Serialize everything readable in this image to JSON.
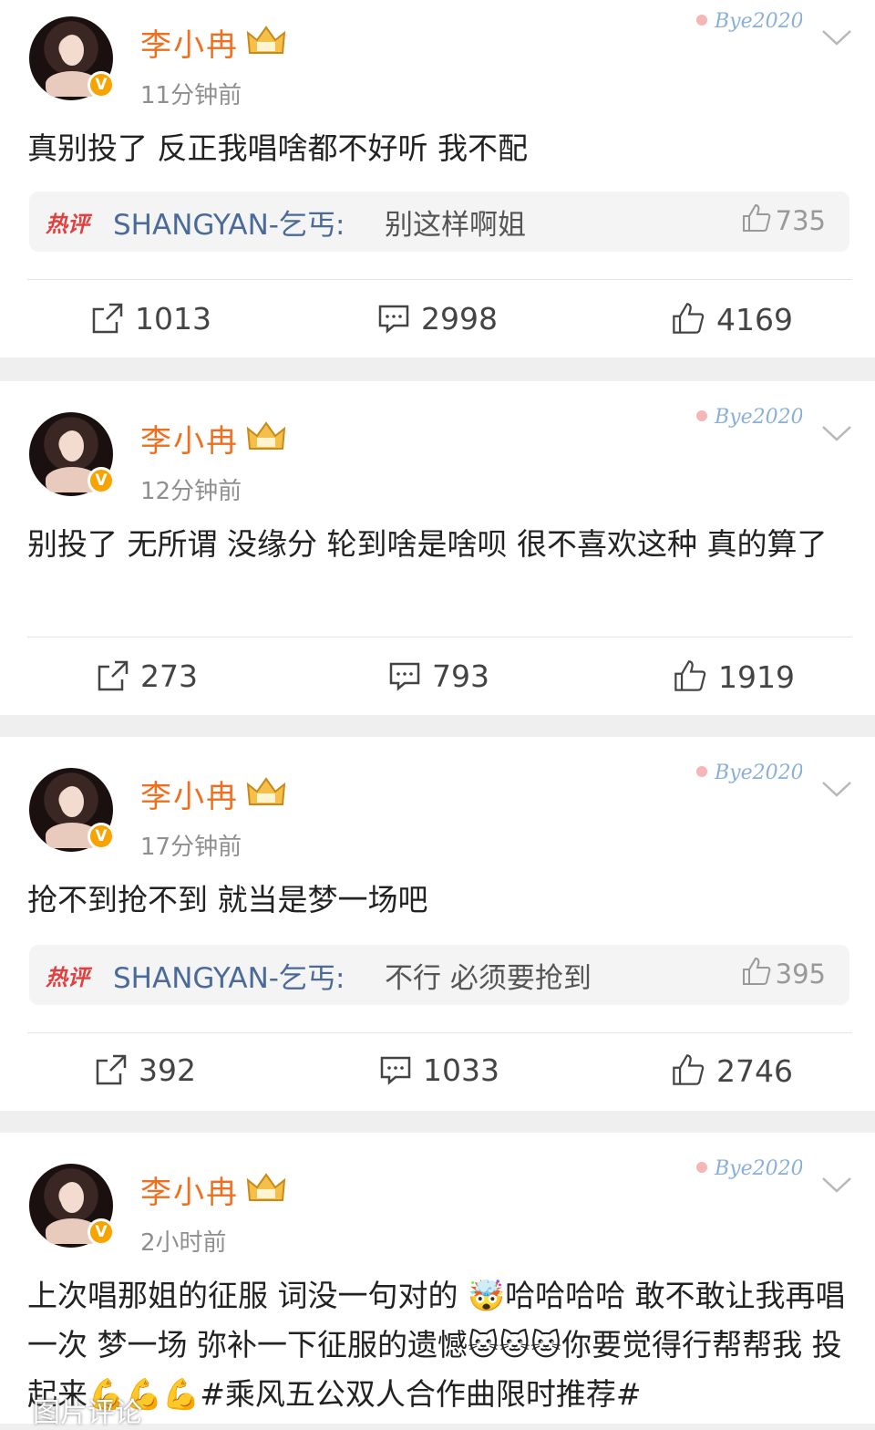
{
  "posts": [
    {
      "user": "李小冉",
      "time": "11分钟前",
      "text": "真别投了 反正我唱啥都不好听 我不配",
      "decor": "Bye2020",
      "hot_comment": {
        "tag": "热评",
        "user": "SHANGYAN-乞丐:",
        "text": "别这样啊姐",
        "likes": "735"
      },
      "reposts": "1013",
      "comments": "2998",
      "likes": "4169"
    },
    {
      "user": "李小冉",
      "time": "12分钟前",
      "text": "别投了 无所谓 没缘分 轮到啥是啥呗 很不喜欢这种 真的算了",
      "decor": "Bye2020",
      "reposts": "273",
      "comments": "793",
      "likes": "1919"
    },
    {
      "user": "李小冉",
      "time": "17分钟前",
      "text": "抢不到抢不到 就当是梦一场吧",
      "decor": "Bye2020",
      "hot_comment": {
        "tag": "热评",
        "user": "SHANGYAN-乞丐:",
        "text": "不行 必须要抢到",
        "likes": "395"
      },
      "reposts": "392",
      "comments": "1033",
      "likes": "2746"
    },
    {
      "user": "李小冉",
      "time": "2小时前",
      "text": "上次唱那姐的征服 词没一句对的 🤯哈哈哈哈 敢不敢让我再唱一次 梦一场 弥补一下征服的遗憾🐱🐱🐱你要觉得行帮帮我 投起来💪💪💪#乘风五公双人合作曲限时推荐#",
      "decor": "Bye2020"
    }
  ],
  "caption": "图片评论",
  "colors": {
    "name": "#f06f1f",
    "badge": "#f7a400",
    "hot_tag": "#e04040",
    "link": "#4a6a9a"
  },
  "icons": {
    "repost": "repost-icon",
    "comment": "comment-icon",
    "like": "thumbs-up-icon",
    "more": "chevron-down-icon",
    "verified": "verified-v-icon",
    "vip": "crown-icon"
  }
}
